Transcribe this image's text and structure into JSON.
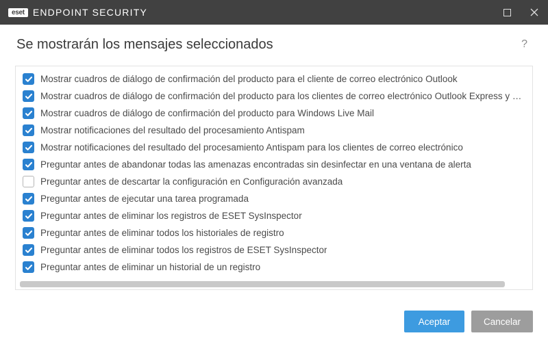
{
  "titlebar": {
    "brand_badge": "eset",
    "product_name": "ENDPOINT SECURITY"
  },
  "header": {
    "title": "Se mostrarán los mensajes seleccionados"
  },
  "messages": [
    {
      "checked": true,
      "label": "Mostrar cuadros de diálogo de confirmación del producto para el cliente de correo electrónico Outlook"
    },
    {
      "checked": true,
      "label": "Mostrar cuadros de diálogo de confirmación del producto para los clientes de correo electrónico Outlook Express y Windows Mail"
    },
    {
      "checked": true,
      "label": "Mostrar cuadros de diálogo de confirmación del producto para Windows Live Mail"
    },
    {
      "checked": true,
      "label": "Mostrar notificaciones del resultado del procesamiento Antispam"
    },
    {
      "checked": true,
      "label": "Mostrar notificaciones del resultado del procesamiento Antispam para los clientes de correo electrónico"
    },
    {
      "checked": true,
      "label": "Preguntar antes de abandonar todas las amenazas encontradas sin desinfectar en una ventana de alerta"
    },
    {
      "checked": false,
      "label": "Preguntar antes de descartar la configuración en Configuración avanzada"
    },
    {
      "checked": true,
      "label": "Preguntar antes de ejecutar una tarea programada"
    },
    {
      "checked": true,
      "label": "Preguntar antes de eliminar los registros de ESET SysInspector"
    },
    {
      "checked": true,
      "label": "Preguntar antes de eliminar todos los historiales de registro"
    },
    {
      "checked": true,
      "label": "Preguntar antes de eliminar todos los registros de ESET SysInspector"
    },
    {
      "checked": true,
      "label": "Preguntar antes de eliminar un historial de un registro"
    }
  ],
  "footer": {
    "ok_label": "Aceptar",
    "cancel_label": "Cancelar"
  }
}
